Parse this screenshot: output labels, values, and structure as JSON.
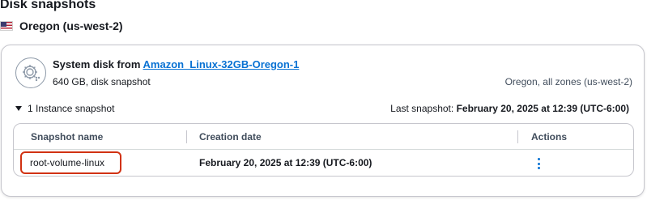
{
  "page": {
    "title": "Disk snapshots"
  },
  "region": {
    "flag_icon": "us-flag-icon",
    "name": "Oregon (us-west-2)"
  },
  "disk": {
    "icon": "gear-disk-icon",
    "title_prefix": "System disk from",
    "source_link": "Amazon_Linux-32GB-Oregon-1",
    "subtitle": "640 GB, disk snapshot",
    "location": "Oregon, all zones (us-west-2)"
  },
  "snapshots_section": {
    "toggle_label": "1 Instance snapshot",
    "last_snapshot_label": "Last snapshot:",
    "last_snapshot_value": "February 20, 2025 at 12:39 (UTC-6:00)"
  },
  "table": {
    "columns": [
      "Snapshot name",
      "Creation date",
      "Actions"
    ],
    "rows": [
      {
        "name": "root-volume-linux",
        "creation_date": "February 20, 2025 at 12:39 (UTC-6:00)",
        "actions_icon": "vertical-ellipsis-icon"
      }
    ]
  },
  "colors": {
    "link": "#0972d3",
    "highlight": "#d13212",
    "border": "#c6c6cd"
  }
}
